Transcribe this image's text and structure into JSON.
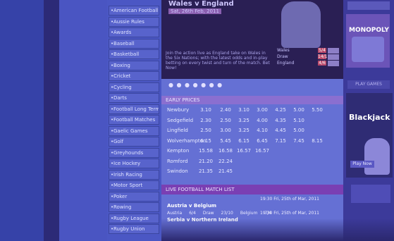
{
  "sidebar": {
    "items": [
      {
        "label": "American Football"
      },
      {
        "label": "Aussie Rules"
      },
      {
        "label": "Awards"
      },
      {
        "label": "Baseball"
      },
      {
        "label": "Basketball"
      },
      {
        "label": "Boxing"
      },
      {
        "label": "Cricket"
      },
      {
        "label": "Cycling"
      },
      {
        "label": "Darts"
      },
      {
        "label": "Football Long Term"
      },
      {
        "label": "Football Matches"
      },
      {
        "label": "Gaelic Games"
      },
      {
        "label": "Golf"
      },
      {
        "label": "Greyhounds"
      },
      {
        "label": "Ice Hockey"
      },
      {
        "label": "Irish Racing"
      },
      {
        "label": "Motor Sport"
      },
      {
        "label": "Poker"
      },
      {
        "label": "Rowing"
      },
      {
        "label": "Rugby League"
      },
      {
        "label": "Rugby Union"
      }
    ]
  },
  "hero": {
    "title": "Wales v England",
    "subtitle": "Sat, 26th Feb, 2011",
    "description": "Join the action live as England take on Wales in the Six Nations; with the latest odds and in-play betting on every twist and turn of the match. Bet Now!",
    "odds": [
      {
        "label": "Wales",
        "value": "5/4"
      },
      {
        "label": "Draw",
        "value": "14/1"
      },
      {
        "label": "England",
        "value": "4/6"
      }
    ],
    "carousel_dots": "● ● ● ● ● ● ●"
  },
  "early_prices": {
    "heading": "EARLY PRICES",
    "rows": [
      {
        "name": "Newbury",
        "odds": [
          "3.10",
          "2.40",
          "3.10",
          "3.00",
          "4.25",
          "5.00",
          "5.50"
        ]
      },
      {
        "name": "Sedgefield",
        "odds": [
          "2.30",
          "2.50",
          "3.25",
          "4.00",
          "4.35",
          "5.10",
          ""
        ]
      },
      {
        "name": "Lingfield",
        "odds": [
          "2.50",
          "3.00",
          "3.25",
          "4.10",
          "4.45",
          "5.00",
          ""
        ]
      },
      {
        "name": "Wolverhampton",
        "odds": [
          "6.15",
          "5.45",
          "6.15",
          "6.45",
          "7.15",
          "7.45",
          "8.15"
        ]
      },
      {
        "name": "Kempton",
        "odds": [
          "15.58",
          "16.58",
          "16.57",
          "16.57",
          "",
          "",
          ""
        ]
      },
      {
        "name": "Romford",
        "odds": [
          "21.20",
          "22.24",
          "",
          "",
          "",
          "",
          ""
        ]
      },
      {
        "name": "Swindon",
        "odds": [
          "21.35",
          "21.45",
          "",
          "",
          "",
          "",
          ""
        ]
      }
    ]
  },
  "fixtures": {
    "heading": "LIVE FOOTBALL MATCH LIST",
    "groups": [
      {
        "date": "19:30 Fri, 25th of Mar, 2011",
        "title": "Austria v Belgium",
        "line": [
          "Austria",
          "6/4",
          "Draw",
          "23/10",
          "Belgium",
          "7/4"
        ]
      },
      {
        "date": "19:30 Fri, 25th of Mar, 2011",
        "title": "Serbia v Northern Ireland",
        "line": []
      }
    ]
  },
  "right_column": {
    "promo_logo": "MONOPOLY",
    "section_heading": "PLAY GAMES",
    "game_title": "Blackjack",
    "play_label": "Play Now"
  },
  "colors": {
    "tint": "#2a2f86",
    "odds_highlight": "#b8486a",
    "header_bar": "#8a6fd0"
  }
}
